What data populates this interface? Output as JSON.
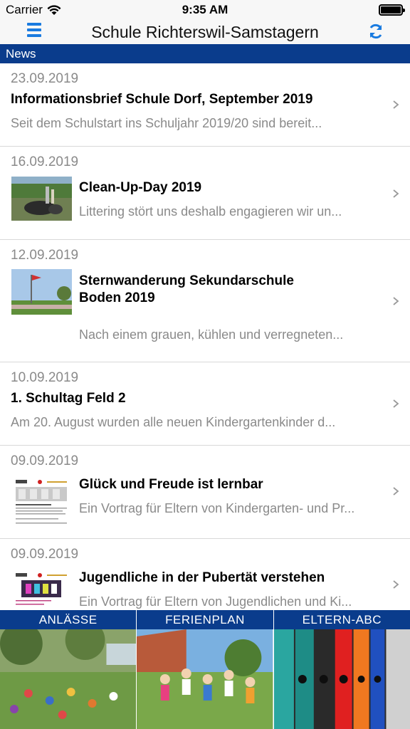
{
  "status_bar": {
    "carrier": "Carrier",
    "time": "9:35 AM"
  },
  "nav": {
    "title": "Schule Richterswil-Samstagern",
    "menu_icon": "hamburger-menu-icon",
    "refresh_icon": "refresh-icon"
  },
  "section": {
    "title": "News"
  },
  "news": [
    {
      "date": "23.09.2019",
      "title": "Informationsbrief Schule Dorf, September 2019",
      "teaser": "Seit dem Schulstart ins Schuljahr 2019/20 sind bereit..."
    },
    {
      "date": "16.09.2019",
      "title": "Clean-Up-Day 2019",
      "teaser": "Littering stört uns  deshalb engagieren wir un..."
    },
    {
      "date": "12.09.2019",
      "title_line1": "Sternwanderung Sekundarschule",
      "title_line2": "Boden 2019",
      "teaser": "Nach einem grauen, kühlen und verregneten..."
    },
    {
      "date": "10.09.2019",
      "title": "1. Schultag Feld 2",
      "teaser": "Am 20. August wurden alle neuen Kindergartenkinder d..."
    },
    {
      "date": "09.09.2019",
      "title": "Glück und Freude ist lernbar",
      "teaser": "Ein Vortrag für Eltern von Kindergarten- und Pr..."
    },
    {
      "date": "09.09.2019",
      "title": "Jugendliche in der Pubertät verstehen",
      "teaser": "Ein Vortrag für Eltern von Jugendlichen und Ki..."
    }
  ],
  "tiles": [
    {
      "label": "ANLÄSSE"
    },
    {
      "label": "FERIENPLAN"
    },
    {
      "label": "ELTERN-ABC"
    }
  ],
  "colors": {
    "accent_blue": "#1a7be0",
    "header_navy": "#0a3c8c",
    "secondary_text": "#8a8a8a"
  }
}
